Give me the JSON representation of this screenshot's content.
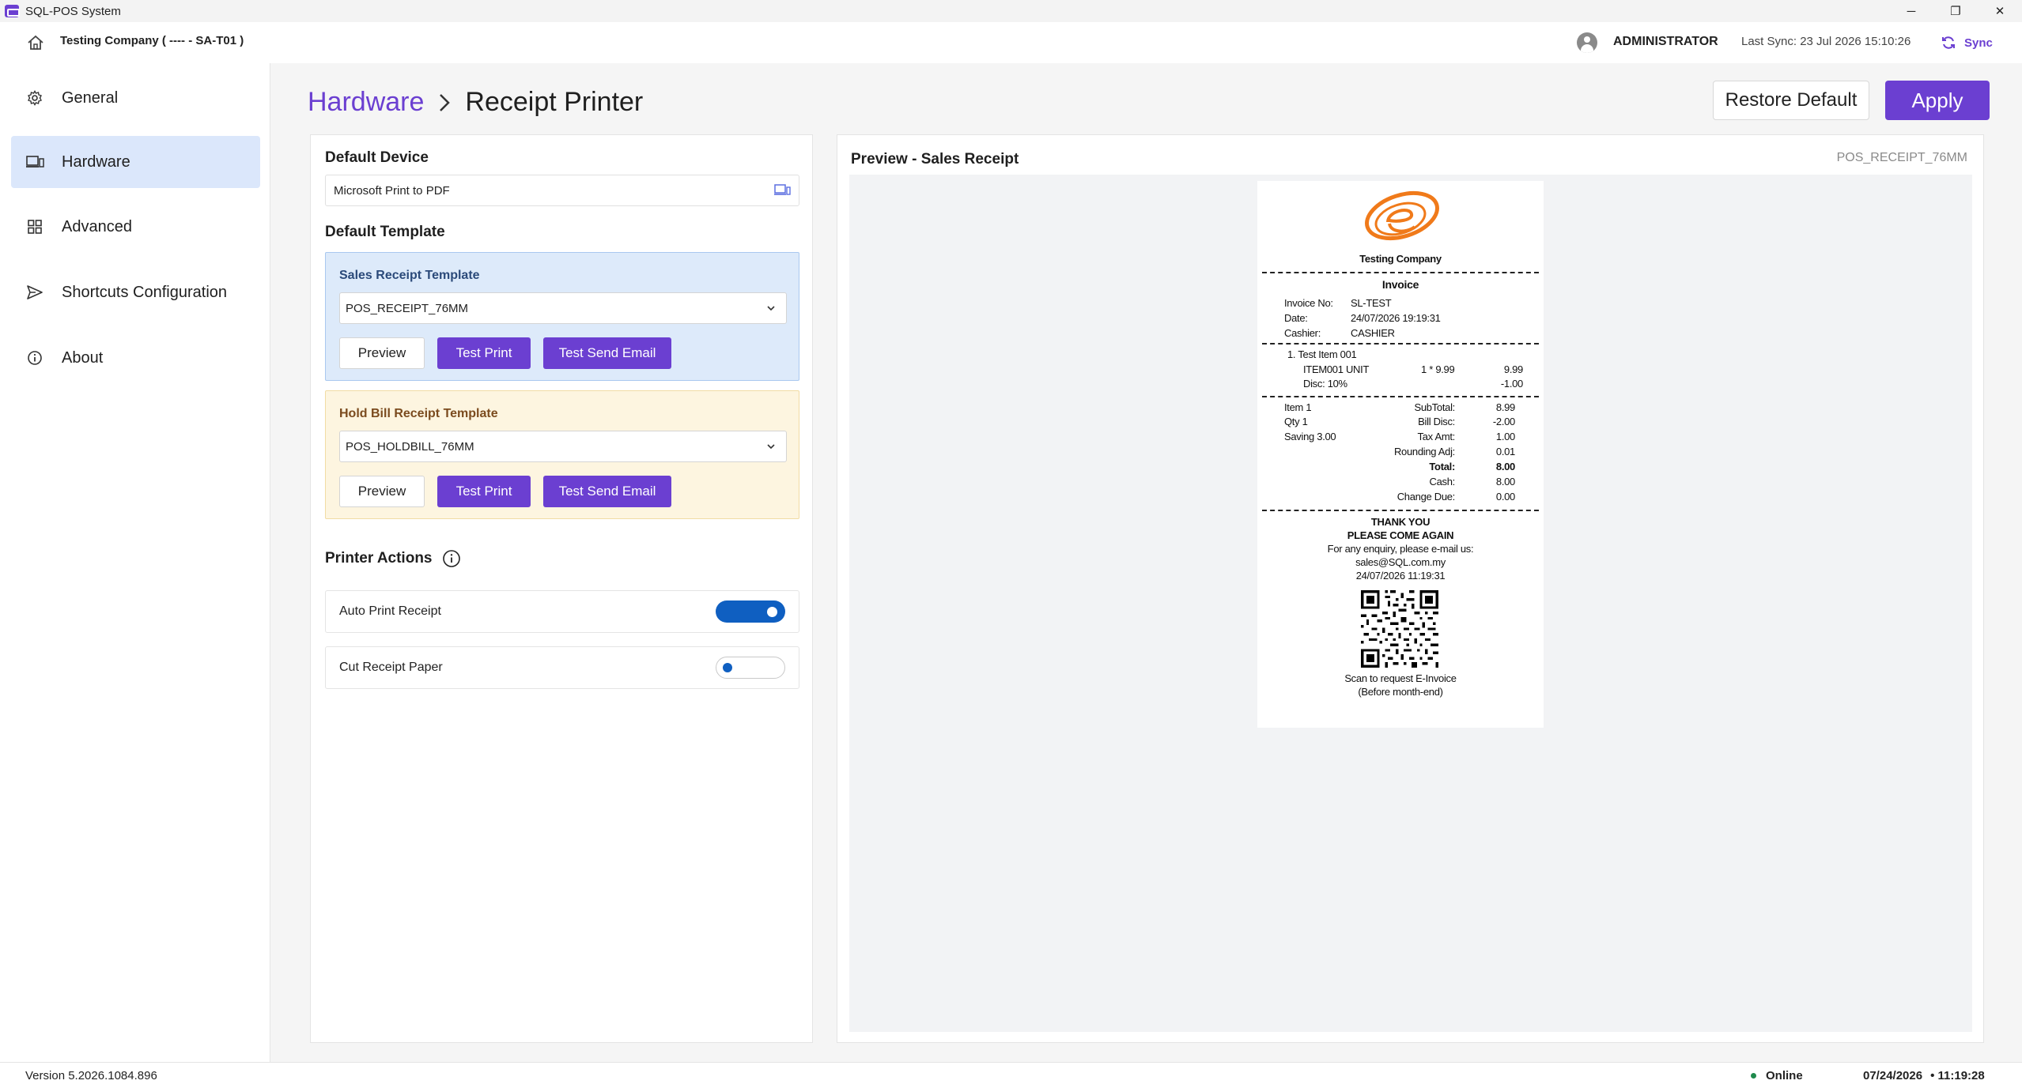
{
  "window": {
    "title": "SQL-POS System",
    "controls": {
      "minimize": "─",
      "restore": "❐",
      "close": "✕"
    }
  },
  "header": {
    "company": "Testing Company ( ---- - SA-T01 )",
    "user": "ADMINISTRATOR",
    "last_sync": "Last Sync: 23 Jul 2026 15:10:26",
    "sync_label": "Sync"
  },
  "sidebar": {
    "items": [
      {
        "label": "General",
        "icon": "gear-icon",
        "active": false
      },
      {
        "label": "Hardware",
        "icon": "device-icon",
        "active": true
      },
      {
        "label": "Advanced",
        "icon": "grid-icon",
        "active": false
      },
      {
        "label": "Shortcuts Configuration",
        "icon": "send-icon",
        "active": false
      },
      {
        "label": "About",
        "icon": "info-icon",
        "active": false
      }
    ]
  },
  "breadcrumb": {
    "parent": "Hardware",
    "current": "Receipt Printer"
  },
  "toolbar": {
    "restore_label": "Restore Default",
    "apply_label": "Apply"
  },
  "settings": {
    "default_device_title": "Default Device",
    "default_device_value": "Microsoft Print to PDF",
    "default_template_title": "Default Template",
    "sales_template": {
      "label": "Sales Receipt Template",
      "value": "POS_RECEIPT_76MM",
      "preview": "Preview",
      "test_print": "Test Print",
      "test_email": "Test Send Email"
    },
    "hold_template": {
      "label": "Hold Bill Receipt Template",
      "value": "POS_HOLDBILL_76MM",
      "preview": "Preview",
      "test_print": "Test Print",
      "test_email": "Test Send Email"
    },
    "printer_actions_title": "Printer Actions",
    "auto_print": {
      "label": "Auto Print Receipt",
      "enabled": true
    },
    "cut_paper": {
      "label": "Cut Receipt Paper",
      "enabled": false
    }
  },
  "preview": {
    "title": "Preview - Sales Receipt",
    "template_tag": "POS_RECEIPT_76MM",
    "receipt": {
      "company": "Testing Company",
      "doc_title": "Invoice",
      "invoice_no_label": "Invoice No:",
      "invoice_no": "SL-TEST",
      "date_label": "Date:",
      "date": "24/07/2026 19:19:31",
      "cashier_label": "Cashier:",
      "cashier": "CASHIER",
      "item_line": "1.   Test Item 001",
      "item_code": "ITEM001 UNIT",
      "item_qty_price": "1 * 9.99",
      "item_amount": "9.99",
      "item_disc_label": "Disc: 10%",
      "item_disc": "-1.00",
      "summary_item": "Item 1",
      "summary_qty": "Qty 1",
      "summary_saving": "Saving 3.00",
      "subtotal_label": "SubTotal:",
      "subtotal": "8.99",
      "billdisc_label": "Bill Disc:",
      "billdisc": "-2.00",
      "taxamt_label": "Tax Amt:",
      "taxamt": "1.00",
      "rounding_label": "Rounding Adj:",
      "rounding": "0.01",
      "total_label": "Total:",
      "total": "8.00",
      "cash_label": "Cash:",
      "cash": "8.00",
      "change_label": "Change Due:",
      "change": "0.00",
      "thank_you": "THANK YOU",
      "come_again": "PLEASE COME AGAIN",
      "enquiry": "For any enquiry, please e-mail us:",
      "email": "sales@SQL.com.my",
      "timestamp": "24/07/2026 11:19:31",
      "scan_text": "Scan to request E-Invoice",
      "scan_note": "(Before month-end)"
    }
  },
  "footer": {
    "version": "Version 5.2026.1084.896",
    "status": "Online",
    "date": "07/24/2026",
    "time": "• 11:19:28"
  },
  "colors": {
    "accent": "#6b3fd1",
    "toggle_on": "#0f5fc1",
    "online": "#1f8a4c"
  }
}
